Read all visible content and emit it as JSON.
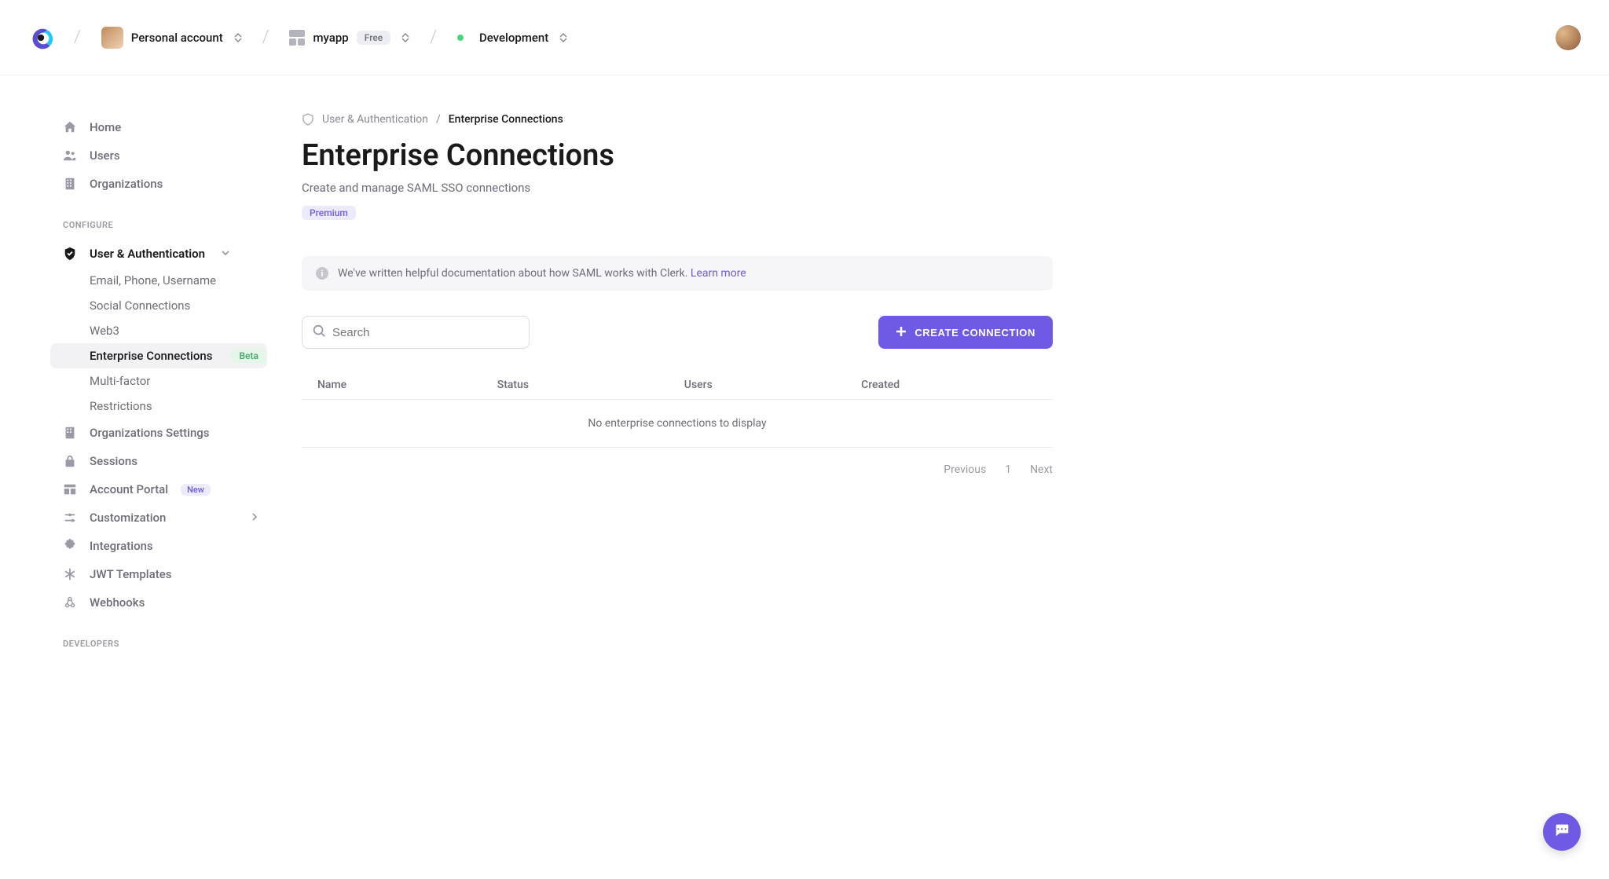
{
  "header": {
    "account": "Personal account",
    "app_name": "myapp",
    "app_plan": "Free",
    "environment": "Development"
  },
  "sidebar": {
    "top": [
      "Home",
      "Users",
      "Organizations"
    ],
    "section1_label": "CONFIGURE",
    "user_auth": {
      "label": "User & Authentication",
      "items": [
        "Email, Phone, Username",
        "Social Connections",
        "Web3",
        "Enterprise Connections",
        "Multi-factor",
        "Restrictions"
      ],
      "beta_badge": "Beta"
    },
    "configure_rest": [
      {
        "label": "Organizations Settings"
      },
      {
        "label": "Sessions"
      },
      {
        "label": "Account Portal",
        "badge": "New"
      },
      {
        "label": "Customization",
        "chevron": true
      },
      {
        "label": "Integrations"
      },
      {
        "label": "JWT Templates"
      },
      {
        "label": "Webhooks"
      }
    ],
    "section2_label": "DEVELOPERS"
  },
  "crumbs": {
    "parent": "User & Authentication",
    "current": "Enterprise Connections"
  },
  "page": {
    "title": "Enterprise Connections",
    "subtitle": "Create and manage SAML SSO connections",
    "premium_badge": "Premium"
  },
  "info_banner": {
    "text": "We've written helpful documentation about how SAML works with Clerk. ",
    "link": "Learn more"
  },
  "search": {
    "placeholder": "Search"
  },
  "create_button": "CREATE CONNECTION",
  "table": {
    "cols": [
      "Name",
      "Status",
      "Users",
      "Created"
    ],
    "empty": "No enterprise connections to display"
  },
  "pager": {
    "prev": "Previous",
    "page": "1",
    "next": "Next"
  }
}
